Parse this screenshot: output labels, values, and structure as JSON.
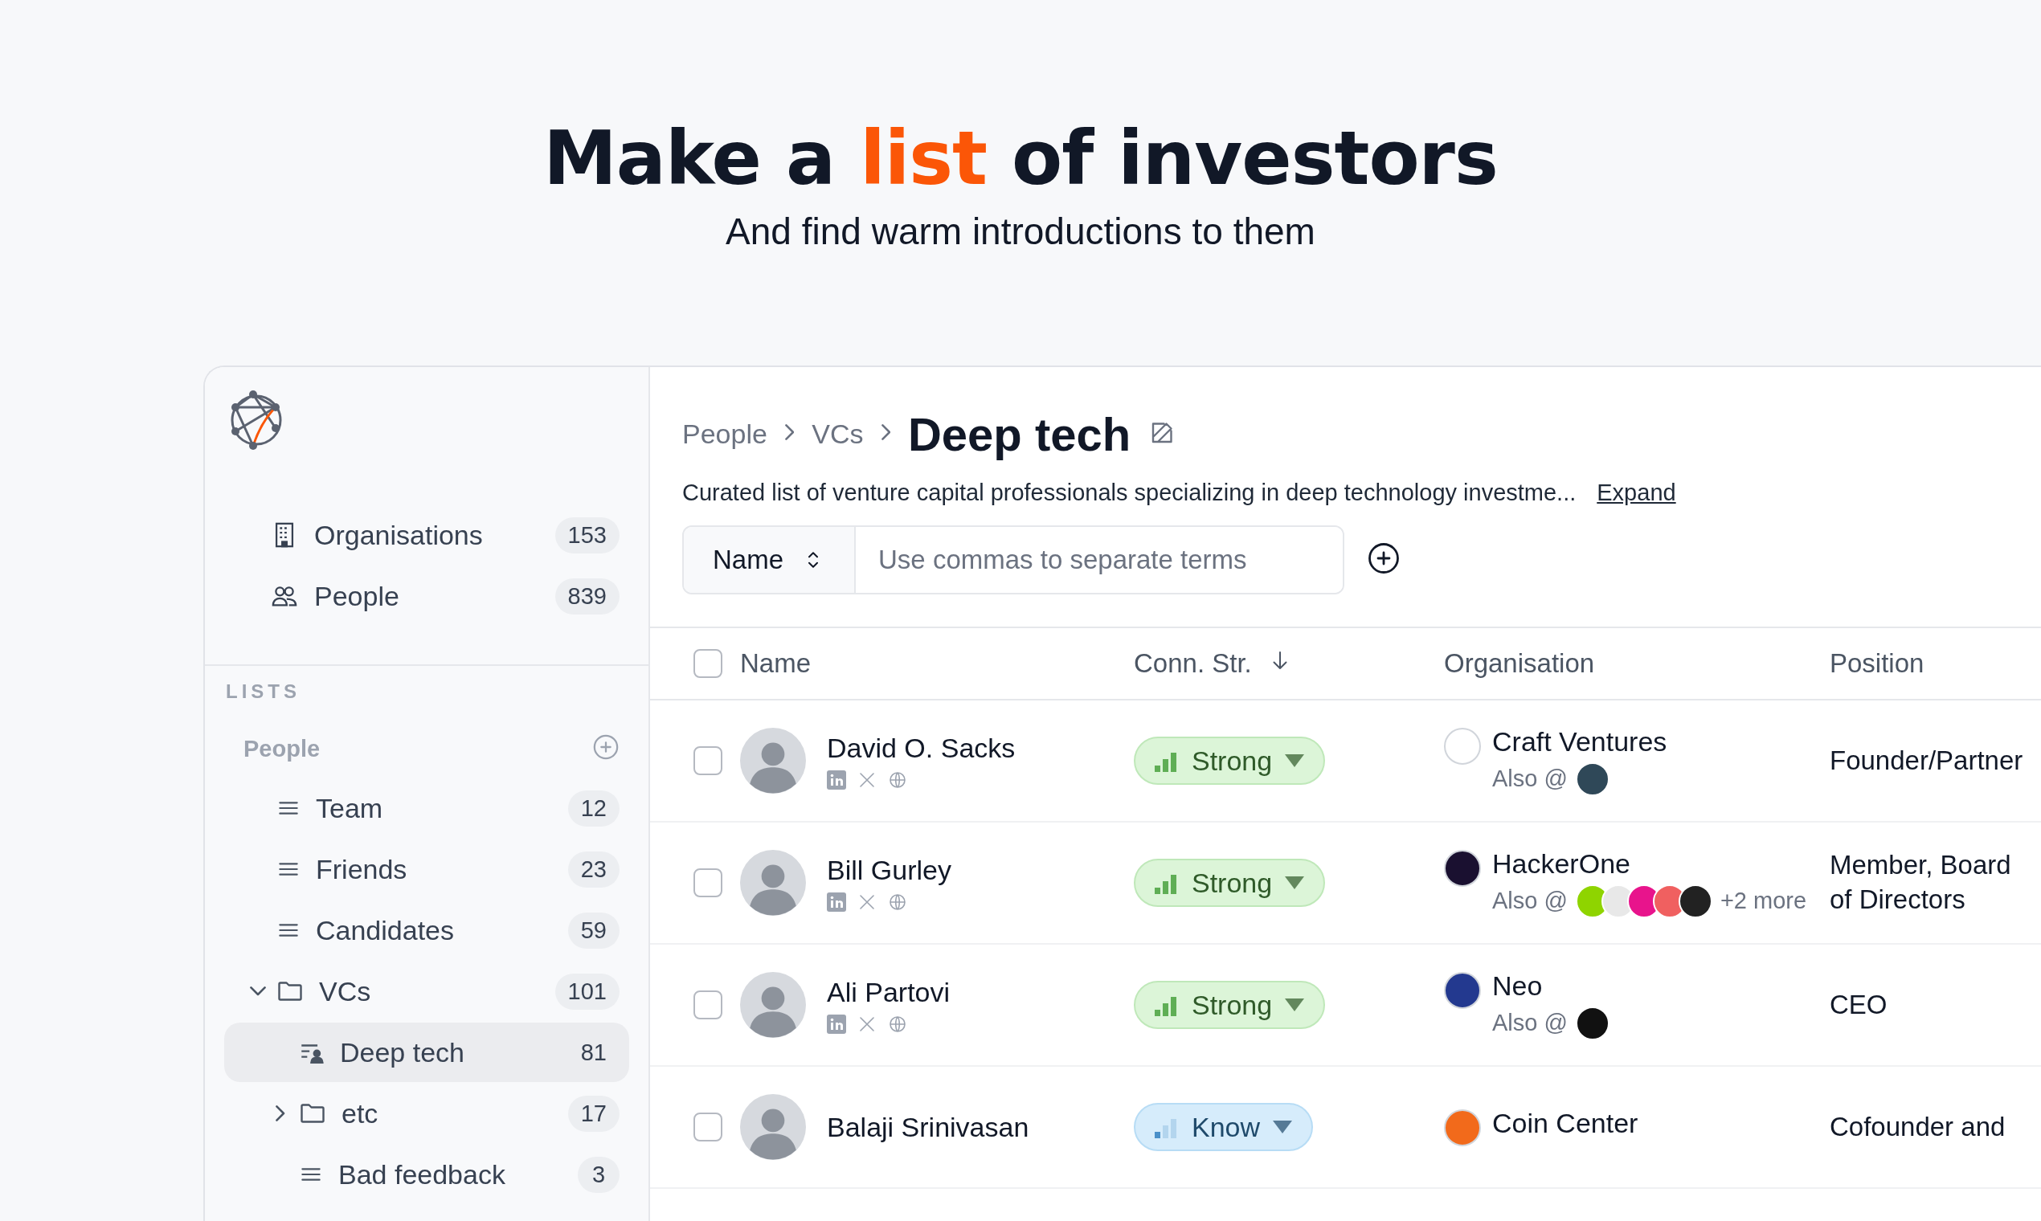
{
  "hero": {
    "title_start": "Make a ",
    "title_highlight": "list",
    "title_end": " of investors",
    "subtitle": "And find warm introductions to them"
  },
  "sidebar": {
    "nav": [
      {
        "label": "Organisations",
        "count": "153"
      },
      {
        "label": "People",
        "count": "839"
      }
    ],
    "section_label": "LISTS",
    "group_label": "People",
    "lists": [
      {
        "kind": "list",
        "label": "Team",
        "count": "12",
        "selected": false
      },
      {
        "kind": "list",
        "label": "Friends",
        "count": "23",
        "selected": false
      },
      {
        "kind": "list",
        "label": "Candidates",
        "count": "59",
        "selected": false
      },
      {
        "kind": "folder",
        "label": "VCs",
        "count": "101",
        "selected": false,
        "expanded": true,
        "children": [
          {
            "kind": "person-list",
            "label": "Deep tech",
            "count": "81",
            "selected": true
          },
          {
            "kind": "folder",
            "label": "etc",
            "count": "17",
            "selected": false,
            "expanded": false
          },
          {
            "kind": "list",
            "label": "Bad feedback",
            "count": "3",
            "selected": false
          }
        ]
      }
    ]
  },
  "main": {
    "breadcrumb": [
      "People",
      "VCs"
    ],
    "title": "Deep tech",
    "description": "Curated list of venture capital professionals specializing in deep technology investme...",
    "expand_link": "Expand",
    "filter": {
      "field": "Name",
      "placeholder": "Use commas to separate terms"
    },
    "table": {
      "select_all": {
        "checked": false
      },
      "columns": [
        {
          "label": "Name",
          "sorted": false
        },
        {
          "label": "Conn. Str.",
          "sorted": true
        },
        {
          "label": "Organisation",
          "sorted": false
        },
        {
          "label": "Position",
          "sorted": false
        }
      ],
      "rows": [
        {
          "selected": false,
          "name": "David O. Sacks",
          "socials": true,
          "connection": {
            "kind": "strong",
            "label": "Strong"
          },
          "organisation": {
            "name": "Craft Ventures",
            "color": "#ffffff",
            "also_label": "Also @",
            "also": [
              {
                "color": "#2f4858"
              }
            ]
          },
          "position": "Founder/Partner"
        },
        {
          "selected": false,
          "name": "Bill Gurley",
          "socials": true,
          "connection": {
            "kind": "strong",
            "label": "Strong"
          },
          "organisation": {
            "name": "HackerOne",
            "color": "#1a1030",
            "also_label": "Also @",
            "also": [
              {
                "color": "#8fd400"
              },
              {
                "color": "#e8e8e8"
              },
              {
                "color": "#e8148c"
              },
              {
                "color": "#f06060"
              },
              {
                "color": "#222222"
              }
            ],
            "more": "+2 more"
          },
          "position": "Member, Board of Directors"
        },
        {
          "selected": false,
          "name": "Ali Partovi",
          "socials": true,
          "connection": {
            "kind": "strong",
            "label": "Strong"
          },
          "organisation": {
            "name": "Neo",
            "color": "#23398f",
            "also_label": "Also @",
            "also": [
              {
                "color": "#111111"
              }
            ]
          },
          "position": "CEO"
        },
        {
          "selected": false,
          "name": "Balaji Srinivasan",
          "socials": false,
          "connection": {
            "kind": "know",
            "label": "Know"
          },
          "organisation": {
            "name": "Coin Center",
            "color": "#f26a1b"
          },
          "position": "Cofounder and"
        }
      ]
    }
  }
}
